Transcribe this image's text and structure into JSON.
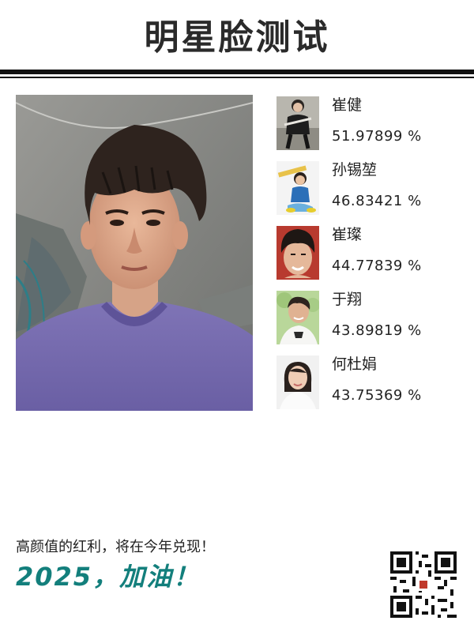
{
  "header": {
    "title": "明星脸测试"
  },
  "matches": [
    {
      "name": "崔健",
      "score": "51.97899 %"
    },
    {
      "name": "孙锡堃",
      "score": "46.83421 %"
    },
    {
      "name": "崔璨",
      "score": "44.77839 %"
    },
    {
      "name": "于翔",
      "score": "43.89819 %"
    },
    {
      "name": "何杜娟",
      "score": "43.75369 %"
    }
  ],
  "footer": {
    "slogan": "高颜值的红利，将在今年兑现！",
    "motto": "2025，加油！"
  },
  "colors": {
    "accent": "#137f7c",
    "rule": "#111111",
    "text": "#222222"
  },
  "icons": {
    "qr": "qr-code-icon"
  }
}
